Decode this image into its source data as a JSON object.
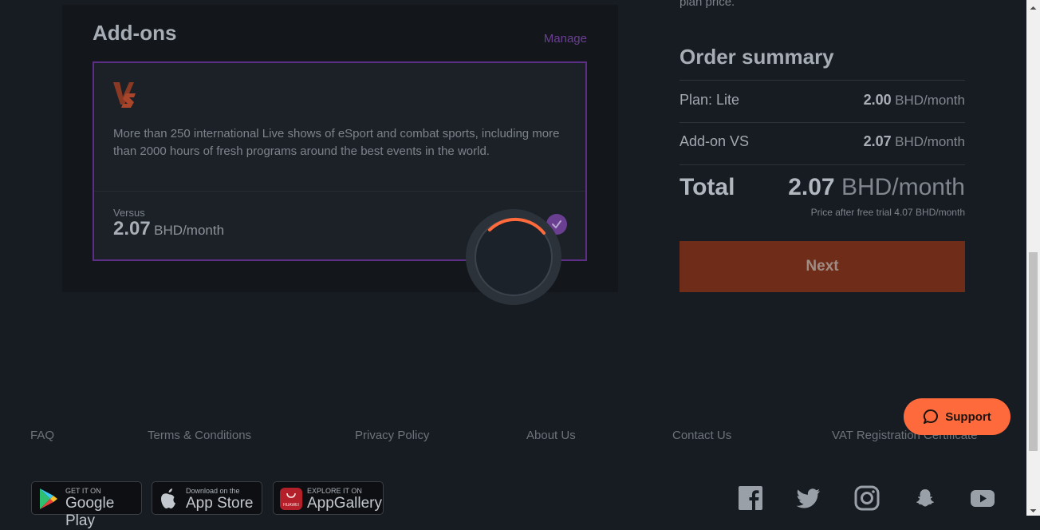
{
  "addons": {
    "title": "Add-ons",
    "manage": "Manage",
    "card": {
      "description": "More than 250 international Live shows of eSport and combat sports, including more than 2000 hours of fresh programs around the best events in the world.",
      "name": "Versus",
      "price": "2.07",
      "unit": "BHD/month",
      "selected": true
    }
  },
  "summary": {
    "plan_price_tail": "plan price.",
    "title": "Order summary",
    "rows": [
      {
        "label": "Plan: Lite",
        "value": "2.00",
        "unit": "BHD/month"
      },
      {
        "label": "Add-on VS",
        "value": "2.07",
        "unit": "BHD/month"
      }
    ],
    "total_label": "Total",
    "total_value": "2.07",
    "total_unit": "BHD/month",
    "total_note": "Price after free trial 4.07 BHD/month",
    "next_label": "Next"
  },
  "footer": {
    "links": [
      "FAQ",
      "Terms & Conditions",
      "Privacy Policy",
      "About Us",
      "Contact Us",
      "VAT Registration Certificate"
    ],
    "support_label": "Support",
    "stores": [
      {
        "small": "GET IT ON",
        "big": "Google Play",
        "icon": "google-play-icon"
      },
      {
        "small": "Download on the",
        "big": "App Store",
        "icon": "apple-icon"
      },
      {
        "small": "EXPLORE IT ON",
        "big": "AppGallery",
        "icon": "huawei-icon",
        "icon_text": "HUAWEI"
      }
    ],
    "social": [
      "facebook-icon",
      "twitter-icon",
      "instagram-icon",
      "snapchat-icon",
      "youtube-icon"
    ]
  },
  "colors": {
    "accent_purple": "#6a3f92",
    "accent_orange": "#ff6a3c",
    "background": "#171c22"
  }
}
